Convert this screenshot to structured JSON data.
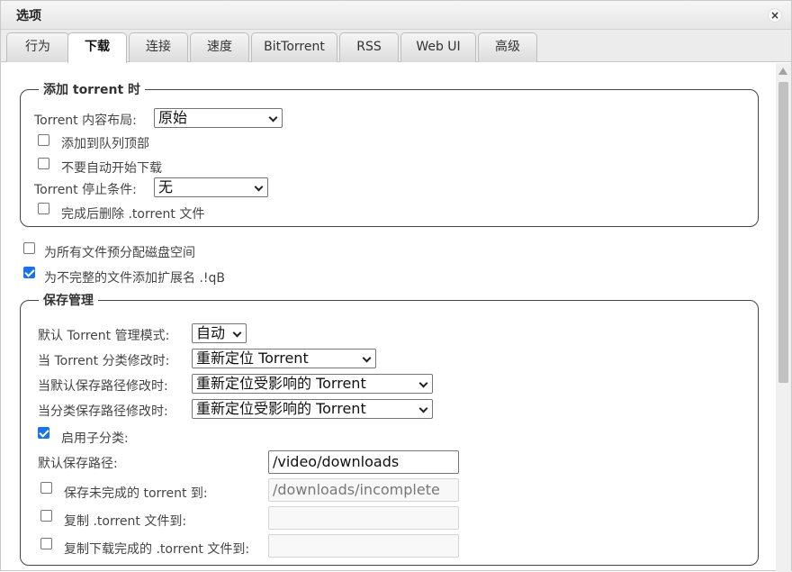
{
  "window": {
    "title": "选项",
    "close_glyph": "×"
  },
  "tabs": [
    {
      "label": "行为",
      "active": false
    },
    {
      "label": "下载",
      "active": true
    },
    {
      "label": "连接",
      "active": false
    },
    {
      "label": "速度",
      "active": false
    },
    {
      "label": "BitTorrent",
      "active": false
    },
    {
      "label": "RSS",
      "active": false
    },
    {
      "label": "Web UI",
      "active": false
    },
    {
      "label": "高级",
      "active": false
    }
  ],
  "add_torrent": {
    "legend": "添加 torrent 时",
    "layout_label": "Torrent 内容布局:",
    "layout_value": "原始",
    "add_to_top_label": "添加到队列顶部",
    "add_to_top_checked": false,
    "no_autostart_label": "不要自动开始下载",
    "no_autostart_checked": false,
    "stop_condition_label": "Torrent 停止条件:",
    "stop_condition_value": "无",
    "delete_torrent_label": "完成后删除 .torrent 文件",
    "delete_torrent_checked": false
  },
  "general": {
    "preallocate_label": "为所有文件预分配磁盘空间",
    "preallocate_checked": false,
    "append_ext_label": "为不完整的文件添加扩展名 .!qB",
    "append_ext_checked": true
  },
  "save_management": {
    "legend": "保存管理",
    "mode_label": "默认 Torrent 管理模式:",
    "mode_value": "自动",
    "category_changed_label": "当 Torrent 分类修改时:",
    "category_changed_value": "重新定位 Torrent",
    "default_path_changed_label": "当默认保存路径修改时:",
    "default_path_changed_value": "重新定位受影响的 Torrent",
    "category_path_changed_label": "当分类保存路径修改时:",
    "category_path_changed_value": "重新定位受影响的 Torrent",
    "subcategories_label": "启用子分类:",
    "subcategories_checked": true,
    "default_save_path_label": "默认保存路径:",
    "default_save_path_value": "/video/downloads",
    "incomplete_label": "保存未完成的 torrent 到:",
    "incomplete_checked": false,
    "incomplete_value": "/downloads/incomplete",
    "copy_torrent_label": "复制 .torrent 文件到:",
    "copy_torrent_checked": false,
    "copy_torrent_value": "",
    "copy_finished_label": "复制下载完成的 .torrent 文件到:",
    "copy_finished_checked": false,
    "copy_finished_value": ""
  }
}
